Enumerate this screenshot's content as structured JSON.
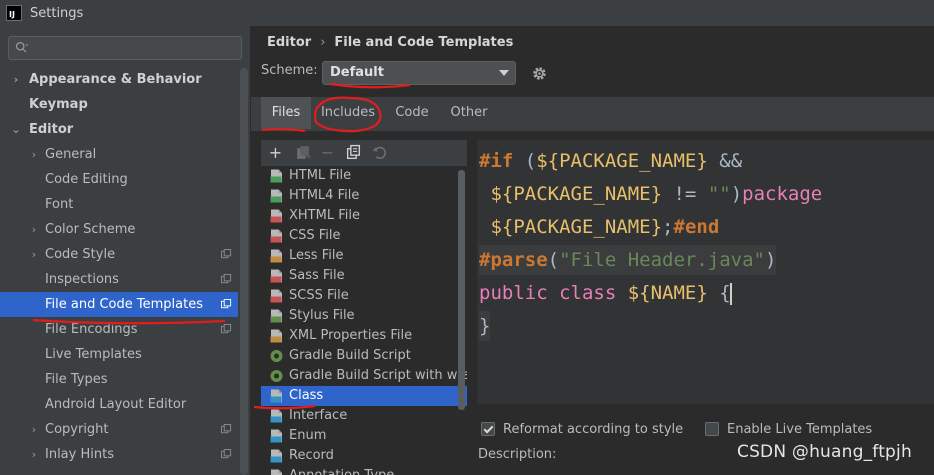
{
  "window": {
    "title": "Settings",
    "app_icon_text": "IJ"
  },
  "search": {
    "placeholder": ""
  },
  "sidebar": {
    "items": [
      {
        "label": "Appearance & Behavior",
        "bold": true,
        "arrow": "›"
      },
      {
        "label": "Keymap",
        "bold": true,
        "arrow": ""
      },
      {
        "label": "Editor",
        "bold": true,
        "arrow": "⌄"
      },
      {
        "label": "General",
        "arrow": "›"
      },
      {
        "label": "Code Editing",
        "arrow": ""
      },
      {
        "label": "Font",
        "arrow": ""
      },
      {
        "label": "Color Scheme",
        "arrow": "›"
      },
      {
        "label": "Code Style",
        "arrow": "›",
        "copy": true
      },
      {
        "label": "Inspections",
        "arrow": "",
        "copy": true
      },
      {
        "label": "File and Code Templates",
        "arrow": "",
        "copy": true,
        "selected": true
      },
      {
        "label": "File Encodings",
        "arrow": "",
        "copy": true
      },
      {
        "label": "Live Templates",
        "arrow": ""
      },
      {
        "label": "File Types",
        "arrow": ""
      },
      {
        "label": "Android Layout Editor",
        "arrow": ""
      },
      {
        "label": "Copyright",
        "arrow": "›",
        "copy": true
      },
      {
        "label": "Inlay Hints",
        "arrow": "›",
        "copy": true
      }
    ]
  },
  "breadcrumb": {
    "parent": "Editor",
    "separator": "›",
    "current": "File and Code Templates"
  },
  "scheme": {
    "label": "Scheme:",
    "value": "Default"
  },
  "tabs": [
    {
      "label": "Files",
      "active": true
    },
    {
      "label": "Includes"
    },
    {
      "label": "Code"
    },
    {
      "label": "Other"
    }
  ],
  "toolbar": {
    "add_label": "+",
    "remove_label": "−"
  },
  "templates": [
    {
      "label": "HTML File",
      "icon": "html-file-icon",
      "color": "#4a9e5c"
    },
    {
      "label": "HTML4 File",
      "icon": "html-file-icon",
      "color": "#4a9e5c"
    },
    {
      "label": "XHTML File",
      "icon": "xhtml-file-icon",
      "color": "#c75450"
    },
    {
      "label": "CSS File",
      "icon": "css-file-icon",
      "color": "#c75450"
    },
    {
      "label": "Less File",
      "icon": "less-file-icon",
      "color": "#c28b3e"
    },
    {
      "label": "Sass File",
      "icon": "sass-file-icon",
      "color": "#c75450"
    },
    {
      "label": "SCSS File",
      "icon": "scss-file-icon",
      "color": "#c75450"
    },
    {
      "label": "Stylus File",
      "icon": "stylus-file-icon",
      "color": "#5f8f4a"
    },
    {
      "label": "XML Properties File",
      "icon": "xml-properties-icon",
      "color": "#c28b3e"
    },
    {
      "label": "Gradle Build Script",
      "icon": "gradle-icon",
      "color": "#5f8f4a"
    },
    {
      "label": "Gradle Build Script with wrapp",
      "icon": "gradle-icon",
      "color": "#5f8f4a"
    },
    {
      "label": "Class",
      "icon": "java-class-icon",
      "color": "#3592c4",
      "selected": true
    },
    {
      "label": "Interface",
      "icon": "java-interface-icon",
      "color": "#3592c4"
    },
    {
      "label": "Enum",
      "icon": "java-enum-icon",
      "color": "#3592c4"
    },
    {
      "label": "Record",
      "icon": "java-record-icon",
      "color": "#3592c4"
    },
    {
      "label": "Annotation Type",
      "icon": "java-annotation-icon",
      "color": "#3592c4"
    }
  ],
  "code": {
    "l1_kw": "#if",
    "l1_a": " (",
    "l1_var": "${PACKAGE_NAME}",
    "l1_b": " &&",
    "l2_a": " ",
    "l2_var": "${PACKAGE_NAME}",
    "l2_b": " != ",
    "l2_str": "\"\"",
    "l2_c": ")",
    "l2_pk": "package",
    "l3_a": " ",
    "l3_var": "${PACKAGE_NAME}",
    "l3_b": ";",
    "l3_kw": "#end",
    "l4_kw": "#parse",
    "l4_a": "(",
    "l4_str": "\"File Header.java\"",
    "l4_b": ")",
    "l5_pk": "public class",
    "l5_a": " ",
    "l5_var": "${NAME}",
    "l5_b": " {",
    "l6_a": "}"
  },
  "options": {
    "reformat_label": "Reformat according to style",
    "reformat_checked": true,
    "live_templates_label": "Enable Live Templates",
    "live_templates_checked": false
  },
  "description": {
    "label": "Description:"
  },
  "watermark": {
    "text": "CSDN @huang_ftpjh"
  },
  "colors": {
    "accent": "#2f65ca",
    "background": "#2b2b2b",
    "panel": "#3c3f41",
    "annotation": "#e01e1e"
  }
}
